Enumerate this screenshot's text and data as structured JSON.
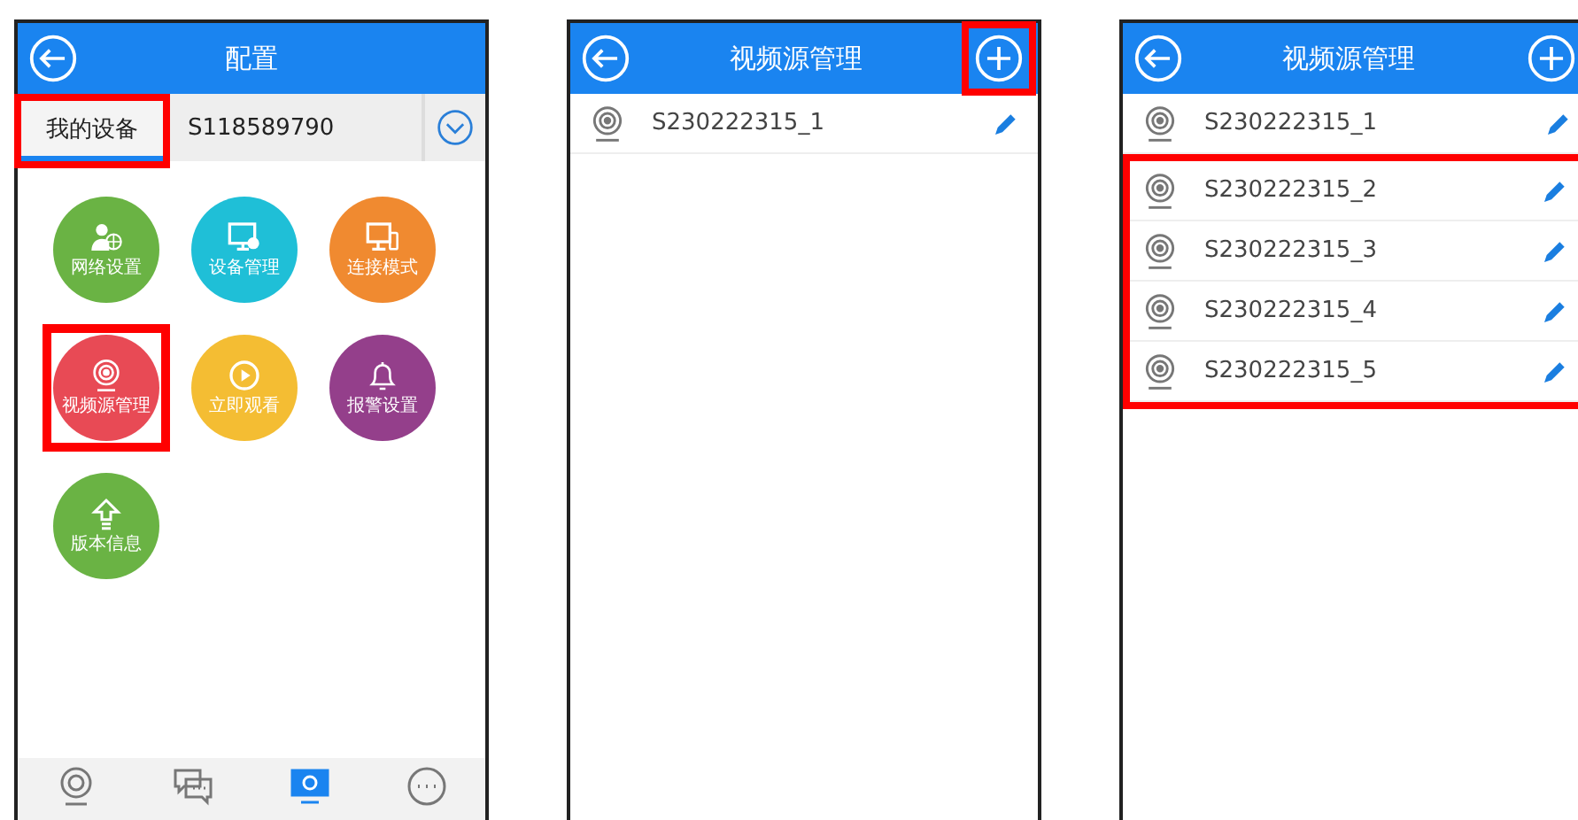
{
  "screens": [
    {
      "kind": "config",
      "title": "配置",
      "tabs": [
        {
          "label": "我的设备",
          "selected": true,
          "highlighted": true
        }
      ],
      "device_id": "S118589790",
      "tiles": [
        {
          "label": "网络设置",
          "color": "#6ab344",
          "highlighted": false
        },
        {
          "label": "设备管理",
          "color": "#1fbfd7",
          "highlighted": false
        },
        {
          "label": "连接模式",
          "color": "#f08a30",
          "highlighted": false
        },
        {
          "label": "视频源管理",
          "color": "#e84a55",
          "highlighted": true
        },
        {
          "label": "立即观看",
          "color": "#f4bd33",
          "highlighted": false
        },
        {
          "label": "报警设置",
          "color": "#943f8b",
          "highlighted": false
        },
        {
          "label": "版本信息",
          "color": "#6ab344",
          "highlighted": false
        }
      ],
      "nav": [
        {
          "selected": false
        },
        {
          "selected": false
        },
        {
          "selected": true
        },
        {
          "selected": false
        }
      ]
    },
    {
      "kind": "list",
      "title": "视频源管理",
      "add_highlighted": true,
      "rows": [
        {
          "label": "S230222315_1"
        }
      ]
    },
    {
      "kind": "list",
      "title": "视频源管理",
      "add_highlighted": false,
      "rows": [
        {
          "label": "S230222315_1"
        }
      ],
      "highlighted_rows": [
        {
          "label": "S230222315_2"
        },
        {
          "label": "S230222315_3"
        },
        {
          "label": "S230222315_4"
        },
        {
          "label": "S230222315_5"
        }
      ]
    }
  ]
}
